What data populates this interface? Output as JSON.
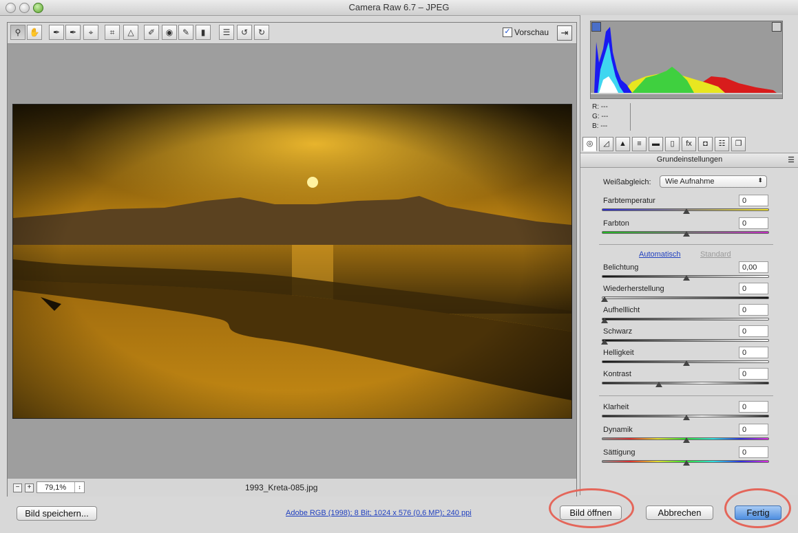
{
  "window": {
    "title": "Camera Raw 6.7 – JPEG"
  },
  "toolbar": {
    "tools": [
      {
        "name": "zoom-tool",
        "glyph": "⚲"
      },
      {
        "name": "hand-tool",
        "glyph": "✋"
      },
      {
        "name": "white-balance-tool",
        "glyph": "✒"
      },
      {
        "name": "color-sampler-tool",
        "glyph": "✒"
      },
      {
        "name": "targeted-adjustment-tool",
        "glyph": "⌖"
      },
      {
        "name": "crop-tool",
        "glyph": "⌗"
      },
      {
        "name": "straighten-tool",
        "glyph": "△"
      },
      {
        "name": "spot-removal-tool",
        "glyph": "✐"
      },
      {
        "name": "red-eye-tool",
        "glyph": "◉"
      },
      {
        "name": "adjustment-brush-tool",
        "glyph": "✎"
      },
      {
        "name": "graduated-filter-tool",
        "glyph": "▮"
      },
      {
        "name": "preferences-tool",
        "glyph": "☰"
      },
      {
        "name": "rotate-left-tool",
        "glyph": "↺"
      },
      {
        "name": "rotate-right-tool",
        "glyph": "↻"
      }
    ],
    "preview_label": "Vorschau",
    "preview_checked": true
  },
  "statusbar": {
    "zoom_out": "−",
    "zoom_in": "+",
    "zoom_value": "79,1%",
    "zoom_stepper": "↕",
    "filename": "1993_Kreta-085.jpg"
  },
  "histogram": {
    "r_label": "R:",
    "r_value": "---",
    "g_label": "G:",
    "g_value": "---",
    "b_label": "B:",
    "b_value": "---"
  },
  "panel_tabs": [
    {
      "name": "tab-basic",
      "glyph": "◎"
    },
    {
      "name": "tab-tone-curve",
      "glyph": "◿"
    },
    {
      "name": "tab-detail",
      "glyph": "▲"
    },
    {
      "name": "tab-hsl",
      "glyph": "≡"
    },
    {
      "name": "tab-split-toning",
      "glyph": "▬"
    },
    {
      "name": "tab-lens-corrections",
      "glyph": "▯"
    },
    {
      "name": "tab-effects",
      "glyph": "fx"
    },
    {
      "name": "tab-camera-calibration",
      "glyph": "◘"
    },
    {
      "name": "tab-presets",
      "glyph": "☷"
    },
    {
      "name": "tab-snapshots",
      "glyph": "❐"
    }
  ],
  "panel": {
    "section_title": "Grundeinstellungen",
    "section_menu": "☰",
    "wb_label": "Weißabgleich:",
    "wb_value": "Wie Aufnahme",
    "auto_link": "Automatisch",
    "default_link": "Standard",
    "sliders": [
      {
        "name": "farbtemperatur",
        "label": "Farbtemperatur",
        "value": "0",
        "level": 0.5,
        "track": "temp"
      },
      {
        "name": "farbton",
        "label": "Farbton",
        "value": "0",
        "level": 0.5,
        "track": "tint"
      },
      {
        "name": "belichtung",
        "label": "Belichtung",
        "value": "0,00",
        "level": 0.5,
        "track": "gray"
      },
      {
        "name": "wiederherstellung",
        "label": "Wiederherstellung",
        "value": "0",
        "level": 0.0,
        "track": "dark"
      },
      {
        "name": "aufhelllicht",
        "label": "Aufhelllicht",
        "value": "0",
        "level": 0.0,
        "track": "light"
      },
      {
        "name": "schwarz",
        "label": "Schwarz",
        "value": "0",
        "level": 0.0,
        "track": "light"
      },
      {
        "name": "helligkeit",
        "label": "Helligkeit",
        "value": "0",
        "level": 0.5,
        "track": "gray"
      },
      {
        "name": "kontrast",
        "label": "Kontrast",
        "value": "0",
        "level": 0.33,
        "track": "contrast"
      },
      {
        "name": "klarheit",
        "label": "Klarheit",
        "value": "0",
        "level": 0.5,
        "track": "contrast"
      },
      {
        "name": "dynamik",
        "label": "Dynamik",
        "value": "0",
        "level": 0.5,
        "track": "rainbow"
      },
      {
        "name": "saettigung",
        "label": "Sättigung",
        "value": "0",
        "level": 0.5,
        "track": "rainbow"
      }
    ]
  },
  "bottom": {
    "save_label": "Bild speichern...",
    "info_link": "Adobe RGB (1998); 8 Bit; 1024 x 576 (0,6 MP); 240 ppi",
    "open_label": "Bild öffnen",
    "cancel_label": "Abbrechen",
    "done_label": "Fertig"
  },
  "colors": {
    "accent": "#4e8ee0",
    "annotation_ring": "#e4665a"
  }
}
